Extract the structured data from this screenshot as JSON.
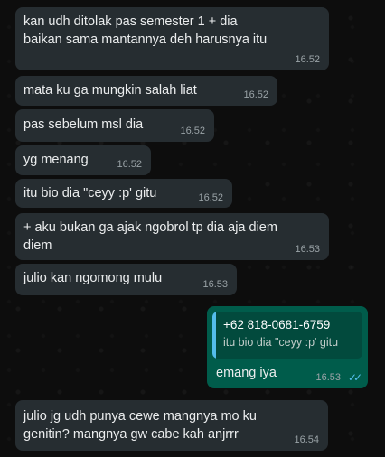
{
  "messages": [
    {
      "text": "kan udh ditolak pas semester 1 + dia\nbaikan sama mantannya deh harusnya itu",
      "time": "16.52"
    },
    {
      "text": "mata ku ga mungkin salah liat",
      "time": "16.52"
    },
    {
      "text": "pas sebelum msl dia",
      "time": "16.52"
    },
    {
      "text": "yg menang",
      "time": "16.52"
    },
    {
      "text": "itu bio dia \"ceyy :p' gitu",
      "time": "16.52"
    },
    {
      "text": "+ aku bukan ga ajak ngobrol tp dia aja diem\ndiem",
      "time": "16.53"
    },
    {
      "text": "julio kan ngomong mulu",
      "time": "16.53"
    }
  ],
  "outgoing": {
    "quote_name": "+62 818-0681-6759",
    "quote_text": "itu bio dia \"ceyy :p' gitu",
    "text": "emang iya",
    "time": "16.53",
    "ticks": "✓✓"
  },
  "last_message": {
    "text": "julio jg udh punya cewe mangnya mo ku\ngenitin? mangnya gw cabe kah anjrrr",
    "time": "16.54"
  },
  "colors": {
    "incoming": "#262d31",
    "outgoing": "#005c4b",
    "read_ticks": "#53bdeb"
  }
}
